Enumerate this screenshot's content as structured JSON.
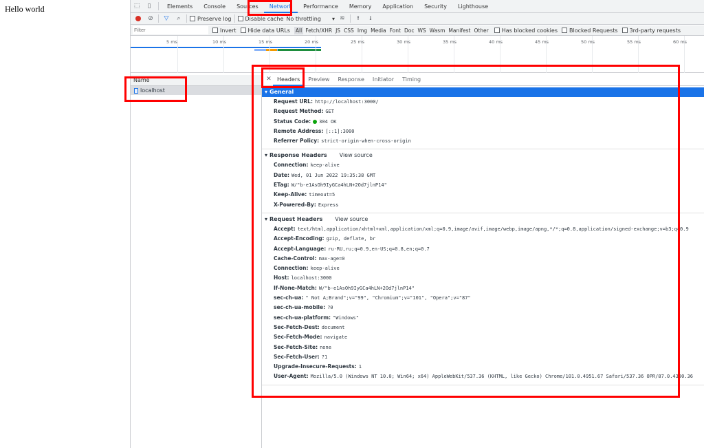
{
  "page": {
    "text": "Hello world"
  },
  "tabs": [
    "Elements",
    "Console",
    "Sources",
    "Network",
    "Performance",
    "Memory",
    "Application",
    "Security",
    "Lighthouse"
  ],
  "toolbar": {
    "preserve_log": "Preserve log",
    "disable_cache": "Disable cache",
    "throttling": "No throttling"
  },
  "filter": {
    "placeholder": "Filter",
    "invert": "Invert",
    "hide_data_urls": "Hide data URLs",
    "types": [
      "All",
      "Fetch/XHR",
      "JS",
      "CSS",
      "Img",
      "Media",
      "Font",
      "Doc",
      "WS",
      "Wasm",
      "Manifest",
      "Other"
    ],
    "has_blocked_cookies": "Has blocked cookies",
    "blocked_requests": "Blocked Requests",
    "third_party": "3rd-party requests"
  },
  "timeline": {
    "labels": [
      "5 ms",
      "10 ms",
      "15 ms",
      "20 ms",
      "25 ms",
      "30 ms",
      "35 ms",
      "40 ms",
      "45 ms",
      "50 ms",
      "55 ms",
      "60 ms"
    ]
  },
  "requests": {
    "header": "Name",
    "rows": [
      "localhost"
    ]
  },
  "detail": {
    "tabs": [
      "Headers",
      "Preview",
      "Response",
      "Initiator",
      "Timing"
    ],
    "general": {
      "title": "General",
      "rows": [
        {
          "k": "Request URL:",
          "v": "http://localhost:3000/"
        },
        {
          "k": "Request Method:",
          "v": "GET"
        },
        {
          "k": "Status Code:",
          "v": "304 OK"
        },
        {
          "k": "Remote Address:",
          "v": "[::1]:3000"
        },
        {
          "k": "Referrer Policy:",
          "v": "strict-origin-when-cross-origin"
        }
      ]
    },
    "response": {
      "title": "Response Headers",
      "view_source": "View source",
      "rows": [
        {
          "k": "Connection:",
          "v": "keep-alive"
        },
        {
          "k": "Date:",
          "v": "Wed, 01 Jun 2022 19:35:38 GMT"
        },
        {
          "k": "ETag:",
          "v": "W/\"b-e1AsOh9IyGCa4hLN+2Od7jlnP14\""
        },
        {
          "k": "Keep-Alive:",
          "v": "timeout=5"
        },
        {
          "k": "X-Powered-By:",
          "v": "Express"
        }
      ]
    },
    "request": {
      "title": "Request Headers",
      "view_source": "View source",
      "rows": [
        {
          "k": "Accept:",
          "v": "text/html,application/xhtml+xml,application/xml;q=0.9,image/avif,image/webp,image/apng,*/*;q=0.8,application/signed-exchange;v=b3;q=0.9"
        },
        {
          "k": "Accept-Encoding:",
          "v": "gzip, deflate, br"
        },
        {
          "k": "Accept-Language:",
          "v": "ru-RU,ru;q=0.9,en-US;q=0.8,en;q=0.7"
        },
        {
          "k": "Cache-Control:",
          "v": "max-age=0"
        },
        {
          "k": "Connection:",
          "v": "keep-alive"
        },
        {
          "k": "Host:",
          "v": "localhost:3000"
        },
        {
          "k": "If-None-Match:",
          "v": "W/\"b-e1AsOh9IyGCa4hLN+2Od7jlnP14\""
        },
        {
          "k": "sec-ch-ua:",
          "v": "\" Not A;Brand\";v=\"99\", \"Chromium\";v=\"101\", \"Opera\";v=\"87\""
        },
        {
          "k": "sec-ch-ua-mobile:",
          "v": "?0"
        },
        {
          "k": "sec-ch-ua-platform:",
          "v": "\"Windows\""
        },
        {
          "k": "Sec-Fetch-Dest:",
          "v": "document"
        },
        {
          "k": "Sec-Fetch-Mode:",
          "v": "navigate"
        },
        {
          "k": "Sec-Fetch-Site:",
          "v": "none"
        },
        {
          "k": "Sec-Fetch-User:",
          "v": "?1"
        },
        {
          "k": "Upgrade-Insecure-Requests:",
          "v": "1"
        },
        {
          "k": "User-Agent:",
          "v": "Mozilla/5.0 (Windows NT 10.0; Win64; x64) AppleWebKit/537.36 (KHTML, like Gecko) Chrome/101.0.4951.67 Safari/537.36 OPR/87.0.4390.36"
        }
      ]
    }
  },
  "icons": {
    "inspect": "inspect-element-icon",
    "device": "device-toolbar-icon",
    "record": "record-icon",
    "clear": "clear-icon",
    "filter": "filter-icon",
    "search": "search-icon",
    "wifi": "network-conditions-icon",
    "upload": "import-har-icon",
    "download": "export-har-icon"
  },
  "colors": {
    "accent": "#1a73e8",
    "annotation": "#ff0000",
    "status_ok": "#0ca40c"
  }
}
